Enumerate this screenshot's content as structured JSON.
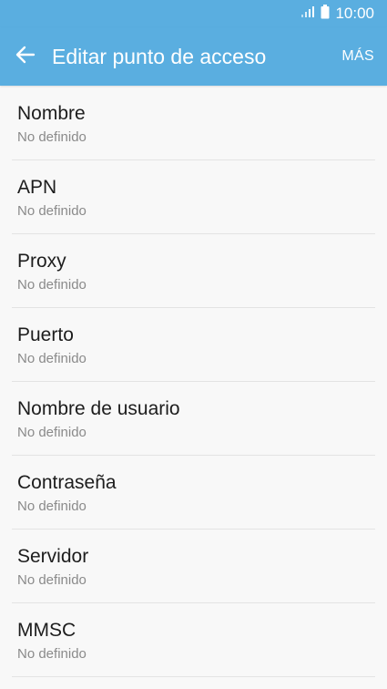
{
  "status_bar": {
    "time": "10:00",
    "signal_icon": "signal-icon",
    "battery_icon": "battery-icon"
  },
  "app_bar": {
    "back_icon": "arrow-left-icon",
    "title": "Editar punto de acceso",
    "more_label": "MÁS"
  },
  "settings": [
    {
      "title": "Nombre",
      "summary": "No definido"
    },
    {
      "title": "APN",
      "summary": "No definido"
    },
    {
      "title": "Proxy",
      "summary": "No definido"
    },
    {
      "title": "Puerto",
      "summary": "No definido"
    },
    {
      "title": "Nombre de usuario",
      "summary": "No definido"
    },
    {
      "title": "Contraseña",
      "summary": "No definido"
    },
    {
      "title": "Servidor",
      "summary": "No definido"
    },
    {
      "title": "MMSC",
      "summary": "No definido"
    }
  ],
  "colors": {
    "app_bar": "#5aaee0",
    "background": "#f8f8f8",
    "title_text": "#1d1d1d",
    "summary_text": "#8a8a8a",
    "divider": "#e3e3e3"
  }
}
